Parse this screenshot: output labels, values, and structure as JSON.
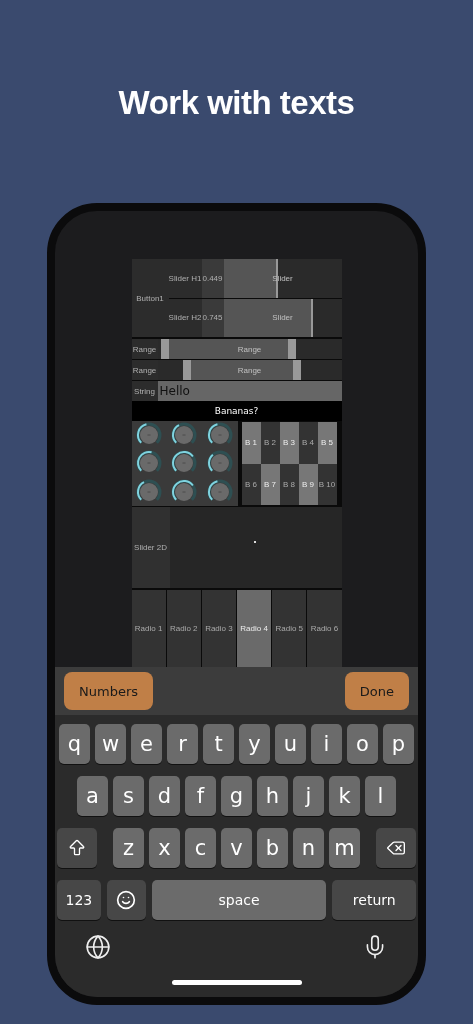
{
  "title": "Work with texts",
  "app": {
    "sliders": {
      "button": "Button1",
      "rows": [
        {
          "label": "Slider H1",
          "value": "0.449",
          "level": 0.449,
          "caption": "Slider"
        },
        {
          "label": "Slider H2",
          "value": "0.745",
          "level": 0.745,
          "caption": "Slider"
        }
      ]
    },
    "ranges": [
      {
        "label": "Range",
        "caption": "Range",
        "start": {
          "level": 0.02
        },
        "end": {
          "level": 0.75
        }
      },
      {
        "label": "Range",
        "caption": "Range",
        "start": {
          "level": 0.14
        },
        "end": {
          "level": 0.78
        }
      }
    ],
    "string": {
      "label": "String",
      "value": "Hello"
    },
    "header": "Bananas?",
    "knobs": [
      {
        "kind": "knob"
      },
      {
        "kind": "knob"
      },
      {
        "kind": "knob"
      },
      {
        "kind": "knob"
      },
      {
        "kind": "knob"
      },
      {
        "kind": "knob"
      },
      {
        "kind": "knob"
      },
      {
        "kind": "knob"
      },
      {
        "kind": "knob"
      }
    ],
    "toggles": [
      {
        "label": "B 1",
        "selected": true
      },
      {
        "label": "B 2",
        "selected": false
      },
      {
        "label": "B 3",
        "selected": true
      },
      {
        "label": "B 4",
        "selected": false
      },
      {
        "label": "B 5",
        "selected": true
      },
      {
        "label": "B 6",
        "selected": false
      },
      {
        "label": "B 7",
        "selected": true
      },
      {
        "label": "B 8",
        "selected": false
      },
      {
        "label": "B 9",
        "selected": true
      },
      {
        "label": "B 10",
        "selected": false
      }
    ],
    "pad": {
      "label": "Slider 2D"
    },
    "radios": [
      {
        "label": "Radio 1",
        "selected": false
      },
      {
        "label": "Radio 2",
        "selected": false
      },
      {
        "label": "Radio 3",
        "selected": false
      },
      {
        "label": "Radio 4",
        "selected": true
      },
      {
        "label": "Radio 5",
        "selected": false
      },
      {
        "label": "Radio 6",
        "selected": false
      }
    ]
  },
  "keyboard": {
    "toolbar": [
      "Numbers",
      "Done"
    ],
    "rows": [
      [
        "q",
        "w",
        "e",
        "r",
        "t",
        "y",
        "u",
        "i",
        "o",
        "p"
      ],
      [
        "a",
        "s",
        "d",
        "f",
        "g",
        "h",
        "j",
        "k",
        "l"
      ],
      [
        "z",
        "x",
        "c",
        "v",
        "b",
        "n",
        "m"
      ]
    ],
    "numbers": "123",
    "space": "space",
    "return": "return"
  }
}
